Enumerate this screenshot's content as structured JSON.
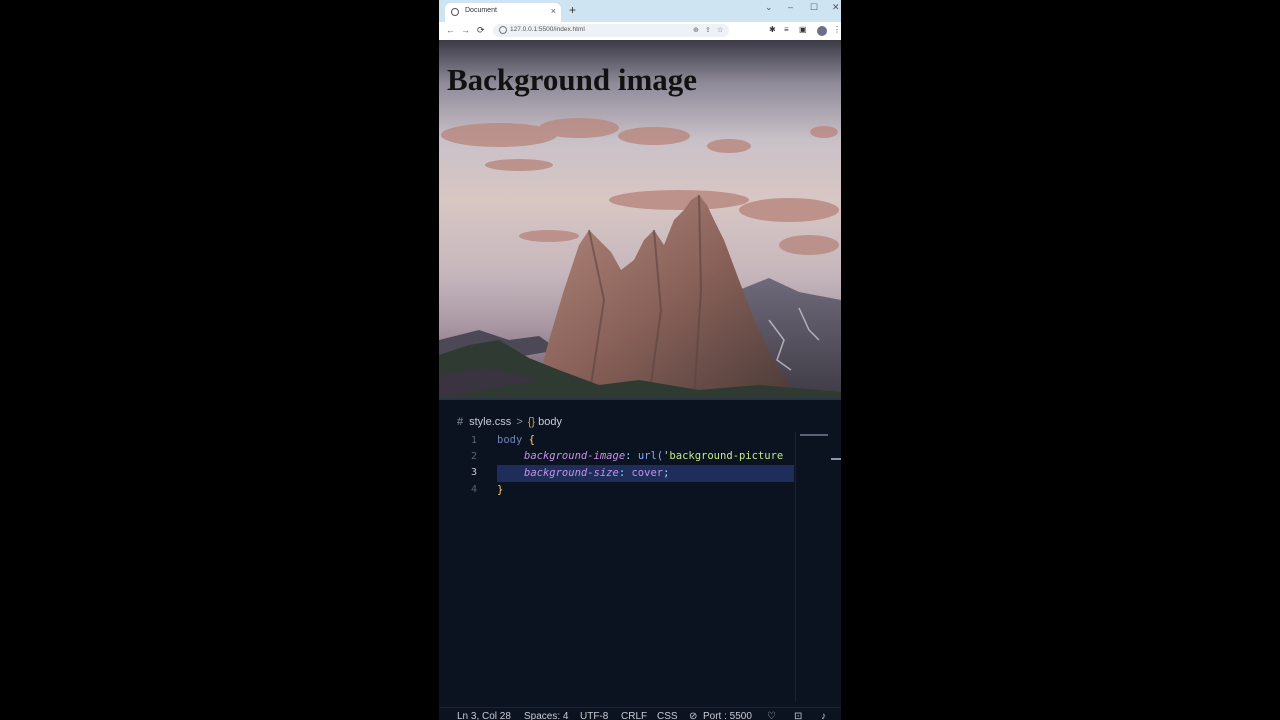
{
  "browser": {
    "tab_title": "Document",
    "tab_close": "×",
    "new_tab": "+",
    "url": "127.0.0.1:5500/index.html",
    "window_controls": [
      "⌄",
      "–",
      "☐",
      "✕"
    ],
    "nav": {
      "back": "←",
      "forward": "→",
      "reload": "⟳"
    },
    "omnibox_icons": [
      "⊕",
      "⇪",
      "☆"
    ],
    "toolbar_icons": [
      "✱",
      "≡",
      "▣",
      "⋮"
    ]
  },
  "page": {
    "heading": "Background image"
  },
  "editor": {
    "breadcrumb": {
      "hash": "#",
      "file": "style.css",
      "separator": ">",
      "symbol_icon": "{}",
      "symbol": "body"
    },
    "line_numbers": [
      "1",
      "2",
      "3",
      "4"
    ],
    "active_line": 3,
    "code": {
      "l1_selector": "body",
      "l1_brace": " {",
      "l2_prop": "background-image",
      "l2_colon": ": ",
      "l2_fn": "url(",
      "l2_str": "'background-picture",
      "l3_prop": "background-size",
      "l3_colon": ": ",
      "l3_val": "cover",
      "l3_semi": ";",
      "l4_brace": "}"
    }
  },
  "status_bar": {
    "position": "Ln 3, Col 28",
    "spaces": "Spaces: 4",
    "encoding": "UTF-8",
    "eol": "CRLF",
    "language": "CSS",
    "port": "Port : 5500",
    "icons": [
      "⊘",
      "♡",
      "⊡",
      "♪"
    ]
  }
}
